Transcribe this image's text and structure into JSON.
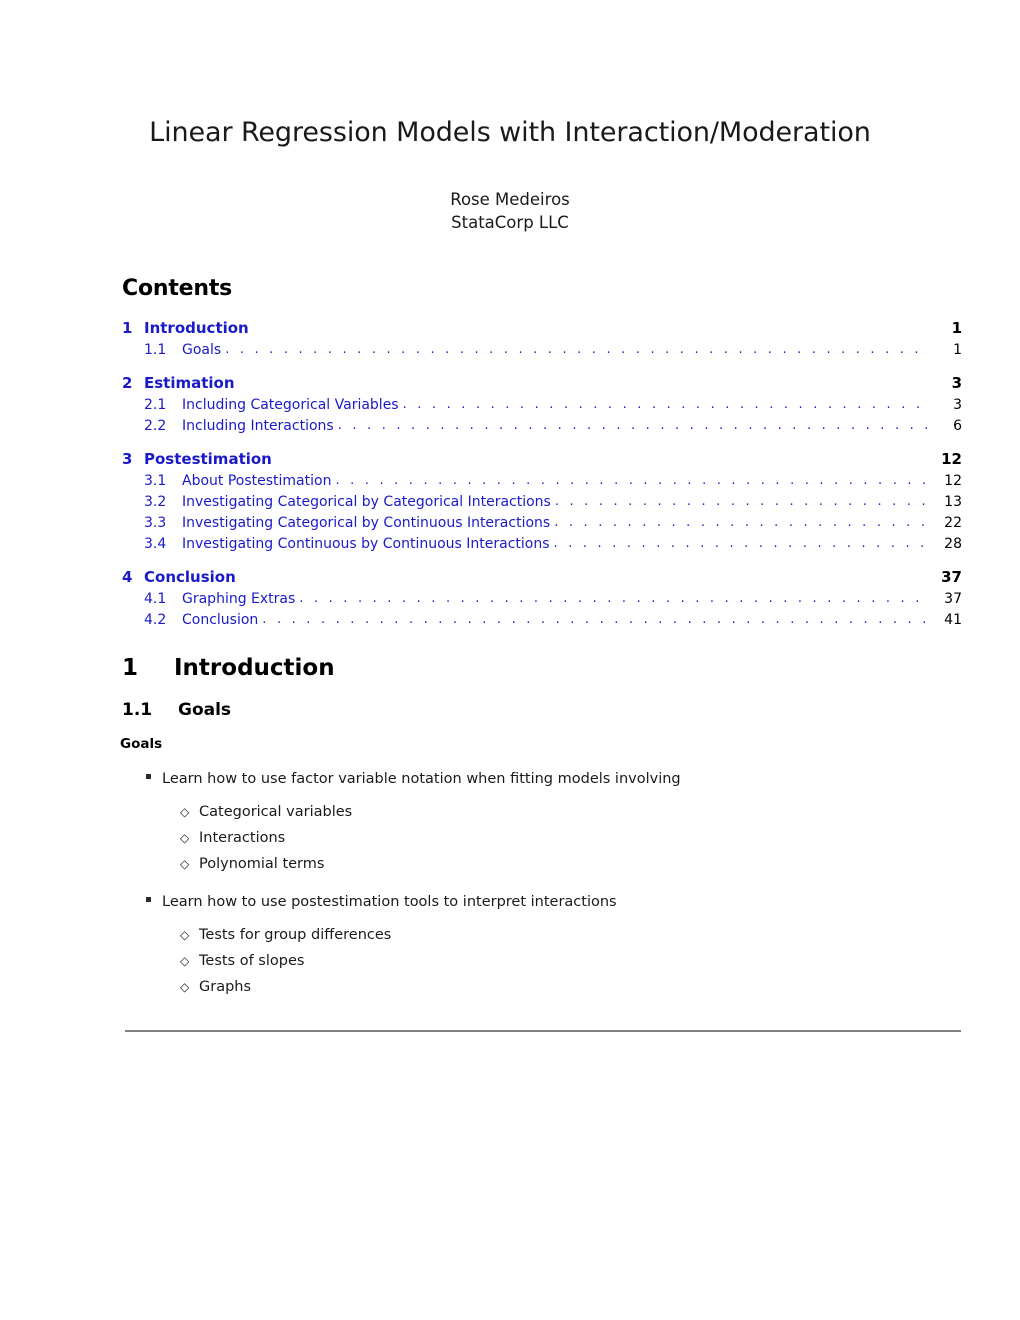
{
  "document": {
    "title": "Linear Regression Models with Interaction/Moderation",
    "author": "Rose Medeiros",
    "affiliation": "StataCorp LLC"
  },
  "contents": {
    "heading": "Contents",
    "groups": [
      {
        "section": {
          "number": "1",
          "title": "Introduction",
          "page": "1"
        },
        "subsections": [
          {
            "number": "1.1",
            "title": "Goals",
            "page": "1"
          }
        ]
      },
      {
        "section": {
          "number": "2",
          "title": "Estimation",
          "page": "3"
        },
        "subsections": [
          {
            "number": "2.1",
            "title": "Including Categorical Variables",
            "page": "3"
          },
          {
            "number": "2.2",
            "title": "Including Interactions",
            "page": "6"
          }
        ]
      },
      {
        "section": {
          "number": "3",
          "title": "Postestimation",
          "page": "12"
        },
        "subsections": [
          {
            "number": "3.1",
            "title": "About Postestimation",
            "page": "12"
          },
          {
            "number": "3.2",
            "title": "Investigating Categorical by Categorical Interactions",
            "page": "13"
          },
          {
            "number": "3.3",
            "title": "Investigating Categorical by Continuous Interactions",
            "page": "22"
          },
          {
            "number": "3.4",
            "title": "Investigating Continuous by Continuous Interactions",
            "page": "28"
          }
        ]
      },
      {
        "section": {
          "number": "4",
          "title": "Conclusion",
          "page": "37"
        },
        "subsections": [
          {
            "number": "4.1",
            "title": "Graphing Extras",
            "page": "37"
          },
          {
            "number": "4.2",
            "title": "Conclusion",
            "page": "41"
          }
        ]
      }
    ],
    "leader_dots": ". . . . . . . . . . . . . . . . . . . . . . . . . . . . . . . . . . . . . . . . . . . . . . . . . . . . . . . . . . . . . . . . . . . . . . . . . . . . . . . . . . ."
  },
  "body": {
    "section": {
      "number": "1",
      "title": "Introduction"
    },
    "subsection": {
      "number": "1.1",
      "title": "Goals"
    },
    "block_label": "Goals",
    "bullets": [
      {
        "text": "Learn how to use factor variable notation when fitting models involving",
        "marker": "filled-square-bullet",
        "subitems": [
          {
            "text": "Categorical variables",
            "marker": "diamond-bullet"
          },
          {
            "text": "Interactions",
            "marker": "diamond-bullet"
          },
          {
            "text": "Polynomial terms",
            "marker": "diamond-bullet"
          }
        ]
      },
      {
        "text": "Learn how to use postestimation tools to interpret interactions",
        "marker": "filled-square-bullet",
        "subitems": [
          {
            "text": "Tests for group differences",
            "marker": "diamond-bullet"
          },
          {
            "text": "Tests of slopes",
            "marker": "diamond-bullet"
          },
          {
            "text": "Graphs",
            "marker": "diamond-bullet"
          }
        ]
      }
    ],
    "diamond_glyph": "◇"
  },
  "colors": {
    "link_blue": "#1a1ac8",
    "text_black": "#1a1a1a",
    "rule_gray": "#808080"
  }
}
